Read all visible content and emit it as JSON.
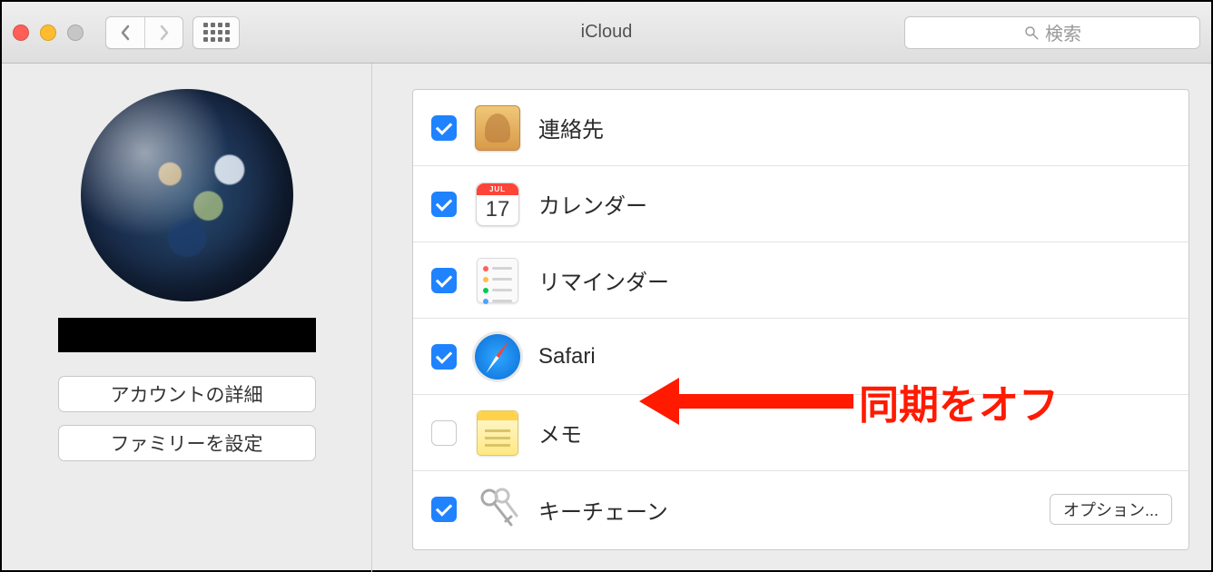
{
  "window": {
    "title": "iCloud"
  },
  "search": {
    "placeholder": "検索"
  },
  "sidebar": {
    "account_details_label": "アカウントの詳細",
    "family_setup_label": "ファミリーを設定"
  },
  "calendar_icon": {
    "month": "JUL",
    "day": "17"
  },
  "services": [
    {
      "id": "contacts",
      "label": "連絡先",
      "checked": true,
      "icon": "contacts"
    },
    {
      "id": "calendar",
      "label": "カレンダー",
      "checked": true,
      "icon": "calendar"
    },
    {
      "id": "reminders",
      "label": "リマインダー",
      "checked": true,
      "icon": "reminders"
    },
    {
      "id": "safari",
      "label": "Safari",
      "checked": true,
      "icon": "safari"
    },
    {
      "id": "notes",
      "label": "メモ",
      "checked": false,
      "icon": "notes"
    },
    {
      "id": "keychain",
      "label": "キーチェーン",
      "checked": true,
      "icon": "keychain",
      "options_label": "オプション..."
    }
  ],
  "annotation": {
    "text": "同期をオフ"
  }
}
